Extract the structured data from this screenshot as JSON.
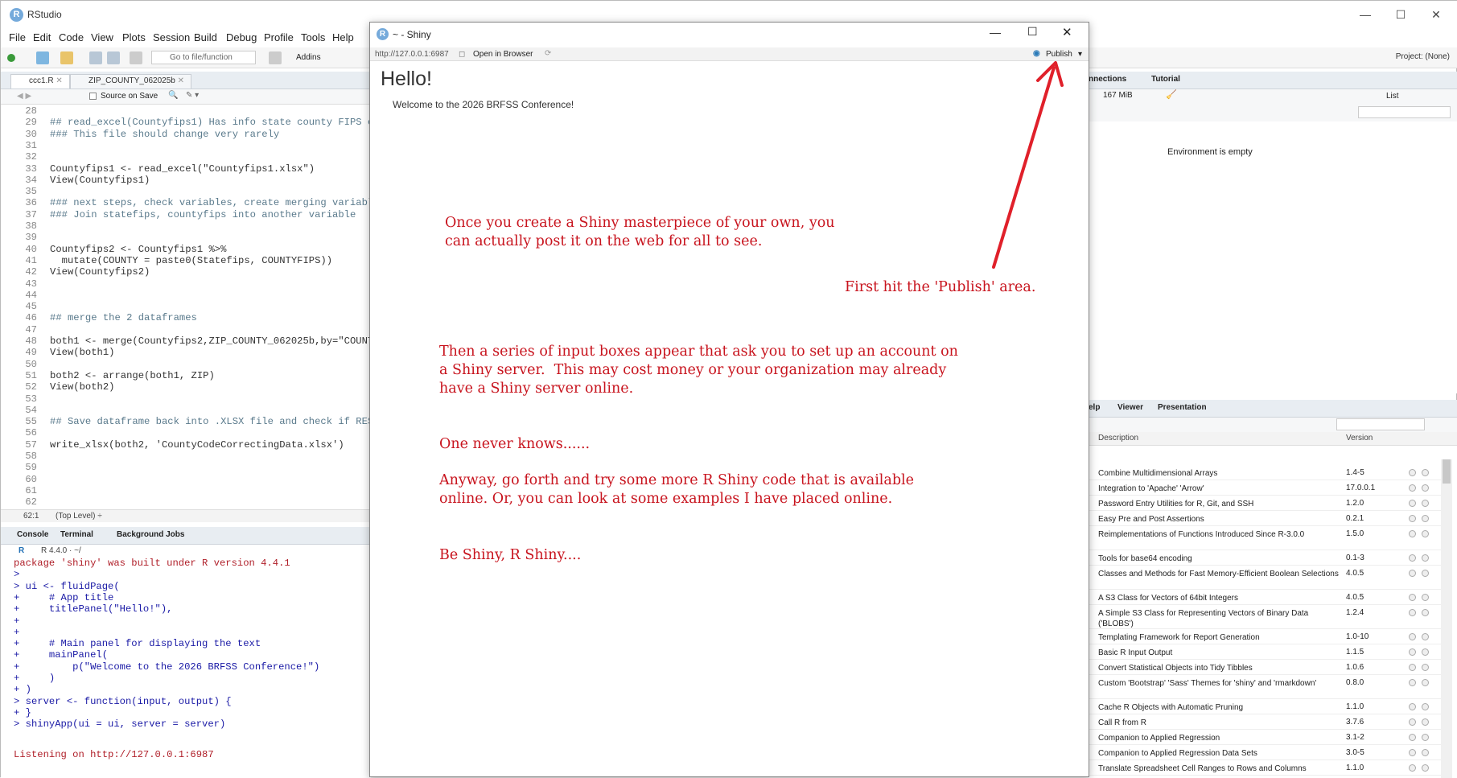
{
  "window": {
    "app_title": "RStudio",
    "minimize": "—",
    "maximize": "☐",
    "close": "✕"
  },
  "menu": [
    "File",
    "Edit",
    "Code",
    "View",
    "Plots",
    "Session",
    "Build",
    "Debug",
    "Profile",
    "Tools",
    "Help"
  ],
  "toolbar": {
    "goto_placeholder": "Go to file/function",
    "addins": "Addins",
    "project": "Project: (None)"
  },
  "source": {
    "tabs": [
      "ccc1.R",
      "ZIP_COUNTY_062025b"
    ],
    "source_on_save": "Source on Save",
    "lines": [
      {
        "n": "28",
        "t": "",
        "c": false
      },
      {
        "n": "29",
        "t": "## read_excel(Countyfips1) Has info state county FIPS c",
        "c": true
      },
      {
        "n": "30",
        "t": "### This file should change very rarely",
        "c": true
      },
      {
        "n": "31",
        "t": "",
        "c": false
      },
      {
        "n": "32",
        "t": "",
        "c": false
      },
      {
        "n": "33",
        "t": "Countyfips1 <- read_excel(\"Countyfips1.xlsx\")",
        "c": false
      },
      {
        "n": "34",
        "t": "View(Countyfips1)",
        "c": false
      },
      {
        "n": "35",
        "t": "",
        "c": false
      },
      {
        "n": "36",
        "t": "### next steps, check variables, create merging variabl",
        "c": true
      },
      {
        "n": "37",
        "t": "### Join statefips, countyfips into another variable",
        "c": true
      },
      {
        "n": "38",
        "t": "",
        "c": false
      },
      {
        "n": "39",
        "t": "",
        "c": false
      },
      {
        "n": "40",
        "t": "Countyfips2 <- Countyfips1 %>%",
        "c": false
      },
      {
        "n": "41",
        "t": "  mutate(COUNTY = paste0(Statefips, COUNTYFIPS))",
        "c": false
      },
      {
        "n": "42",
        "t": "View(Countyfips2)",
        "c": false
      },
      {
        "n": "43",
        "t": "",
        "c": false
      },
      {
        "n": "44",
        "t": "",
        "c": false
      },
      {
        "n": "45",
        "t": "",
        "c": false
      },
      {
        "n": "46",
        "t": "## merge the 2 dataframes",
        "c": true
      },
      {
        "n": "47",
        "t": "",
        "c": false
      },
      {
        "n": "48",
        "t": "both1 <- merge(Countyfips2,ZIP_COUNTY_062025b,by=\"COUNT",
        "c": false
      },
      {
        "n": "49",
        "t": "View(both1)",
        "c": false
      },
      {
        "n": "50",
        "t": "",
        "c": false
      },
      {
        "n": "51",
        "t": "both2 <- arrange(both1, ZIP)",
        "c": false
      },
      {
        "n": "52",
        "t": "View(both2)",
        "c": false
      },
      {
        "n": "53",
        "t": "",
        "c": false
      },
      {
        "n": "54",
        "t": "",
        "c": false
      },
      {
        "n": "55",
        "t": "## Save dataframe back into .XLSX file and check if RES",
        "c": true
      },
      {
        "n": "56",
        "t": "",
        "c": false
      },
      {
        "n": "57",
        "t": "write_xlsx(both2, 'CountyCodeCorrectingData.xlsx')",
        "c": false
      },
      {
        "n": "58",
        "t": "",
        "c": false
      },
      {
        "n": "59",
        "t": "",
        "c": false
      },
      {
        "n": "60",
        "t": "",
        "c": false
      },
      {
        "n": "61",
        "t": "",
        "c": false
      },
      {
        "n": "62",
        "t": "",
        "c": false
      }
    ],
    "status_pos": "62:1",
    "status_scope": "(Top Level) ÷"
  },
  "console": {
    "tabs": [
      "Console",
      "Terminal",
      "Background Jobs"
    ],
    "path": "R 4.4.0 · ~/",
    "lines": [
      {
        "t": "package 'shiny' was built under R version 4.4.1",
        "k": "red"
      },
      {
        "t": ">",
        "k": "prompt"
      },
      {
        "t": "> ui <- fluidPage(",
        "k": "prompt"
      },
      {
        "t": "+     # App title",
        "k": "prompt"
      },
      {
        "t": "+     titlePanel(\"Hello!\"),",
        "k": "prompt"
      },
      {
        "t": "+",
        "k": "prompt"
      },
      {
        "t": "+",
        "k": "prompt"
      },
      {
        "t": "+     # Main panel for displaying the text",
        "k": "prompt"
      },
      {
        "t": "+     mainPanel(",
        "k": "prompt"
      },
      {
        "t": "+         p(\"Welcome to the 2026 BRFSS Conference!\")",
        "k": "prompt"
      },
      {
        "t": "+     )",
        "k": "prompt"
      },
      {
        "t": "+ )",
        "k": "prompt"
      },
      {
        "t": "> server <- function(input, output) {",
        "k": "prompt"
      },
      {
        "t": "+ }",
        "k": "prompt"
      },
      {
        "t": "> shinyApp(ui = ui, server = server)",
        "k": "prompt"
      },
      {
        "t": "",
        "k": "prompt"
      },
      {
        "t": "Listening on http://127.0.0.1:6987",
        "k": "red"
      }
    ]
  },
  "env": {
    "tabs": [
      "nnections",
      "Tutorial"
    ],
    "memory": "167 MiB",
    "view": "List",
    "empty": "Environment is empty"
  },
  "packages": {
    "tabs": [
      "elp",
      "Viewer",
      "Presentation"
    ],
    "col_desc": "Description",
    "col_ver": "Version",
    "rows": [
      {
        "d": "Combine Multidimensional Arrays",
        "v": "1.4-5"
      },
      {
        "d": "Integration to 'Apache' 'Arrow'",
        "v": "17.0.0.1"
      },
      {
        "d": "Password Entry Utilities for R, Git, and SSH",
        "v": "1.2.0"
      },
      {
        "d": "Easy Pre and Post Assertions",
        "v": "0.2.1"
      },
      {
        "d": "Reimplementations of Functions Introduced Since R-3.0.0",
        "v": "1.5.0"
      },
      {
        "d": "Tools for base64 encoding",
        "v": "0.1-3"
      },
      {
        "d": "Classes and Methods for Fast Memory-Efficient Boolean Selections",
        "v": "4.0.5"
      },
      {
        "d": "A S3 Class for Vectors of 64bit Integers",
        "v": "4.0.5"
      },
      {
        "d": "A Simple S3 Class for Representing Vectors of Binary Data ('BLOBS')",
        "v": "1.2.4"
      },
      {
        "d": "Templating Framework for Report Generation",
        "v": "1.0-10"
      },
      {
        "d": "Basic R Input Output",
        "v": "1.1.5"
      },
      {
        "d": "Convert Statistical Objects into Tidy Tibbles",
        "v": "1.0.6"
      },
      {
        "d": "Custom 'Bootstrap' 'Sass' Themes for 'shiny' and 'rmarkdown'",
        "v": "0.8.0"
      },
      {
        "d": "Cache R Objects with Automatic Pruning",
        "v": "1.1.0"
      },
      {
        "d": "Call R from R",
        "v": "3.7.6"
      },
      {
        "d": "Companion to Applied Regression",
        "v": "3.1-2"
      },
      {
        "d": "Companion to Applied Regression Data Sets",
        "v": "3.0-5"
      },
      {
        "d": "Translate Spreadsheet Cell Ranges to Rows and Columns",
        "v": "1.1.0"
      }
    ]
  },
  "shiny": {
    "title": "~ - Shiny",
    "url": "http://127.0.0.1:6987",
    "open_browser": "Open in Browser",
    "publish": "Publish",
    "heading": "Hello!",
    "welcome": "Welcome to the 2026 BRFSS Conference!",
    "annotations": {
      "a1": "Once you create a Shiny masterpiece of your own, you\ncan actually post it on the web for all to see.",
      "a2": "First hit the 'Publish' area.",
      "a3": "Then a series of input boxes appear that ask you to set up an account on\na Shiny server.  This may cost money or your organization may already\nhave a Shiny server online.",
      "a4": "One never knows......",
      "a5": "Anyway, go forth and try some more R Shiny code that is available\nonline. Or, you can look at some examples I have placed online.",
      "a6": "Be Shiny, R Shiny...."
    }
  },
  "colors": {
    "annotation": "#c8141e",
    "rstudio_blue": "#75aadb"
  }
}
